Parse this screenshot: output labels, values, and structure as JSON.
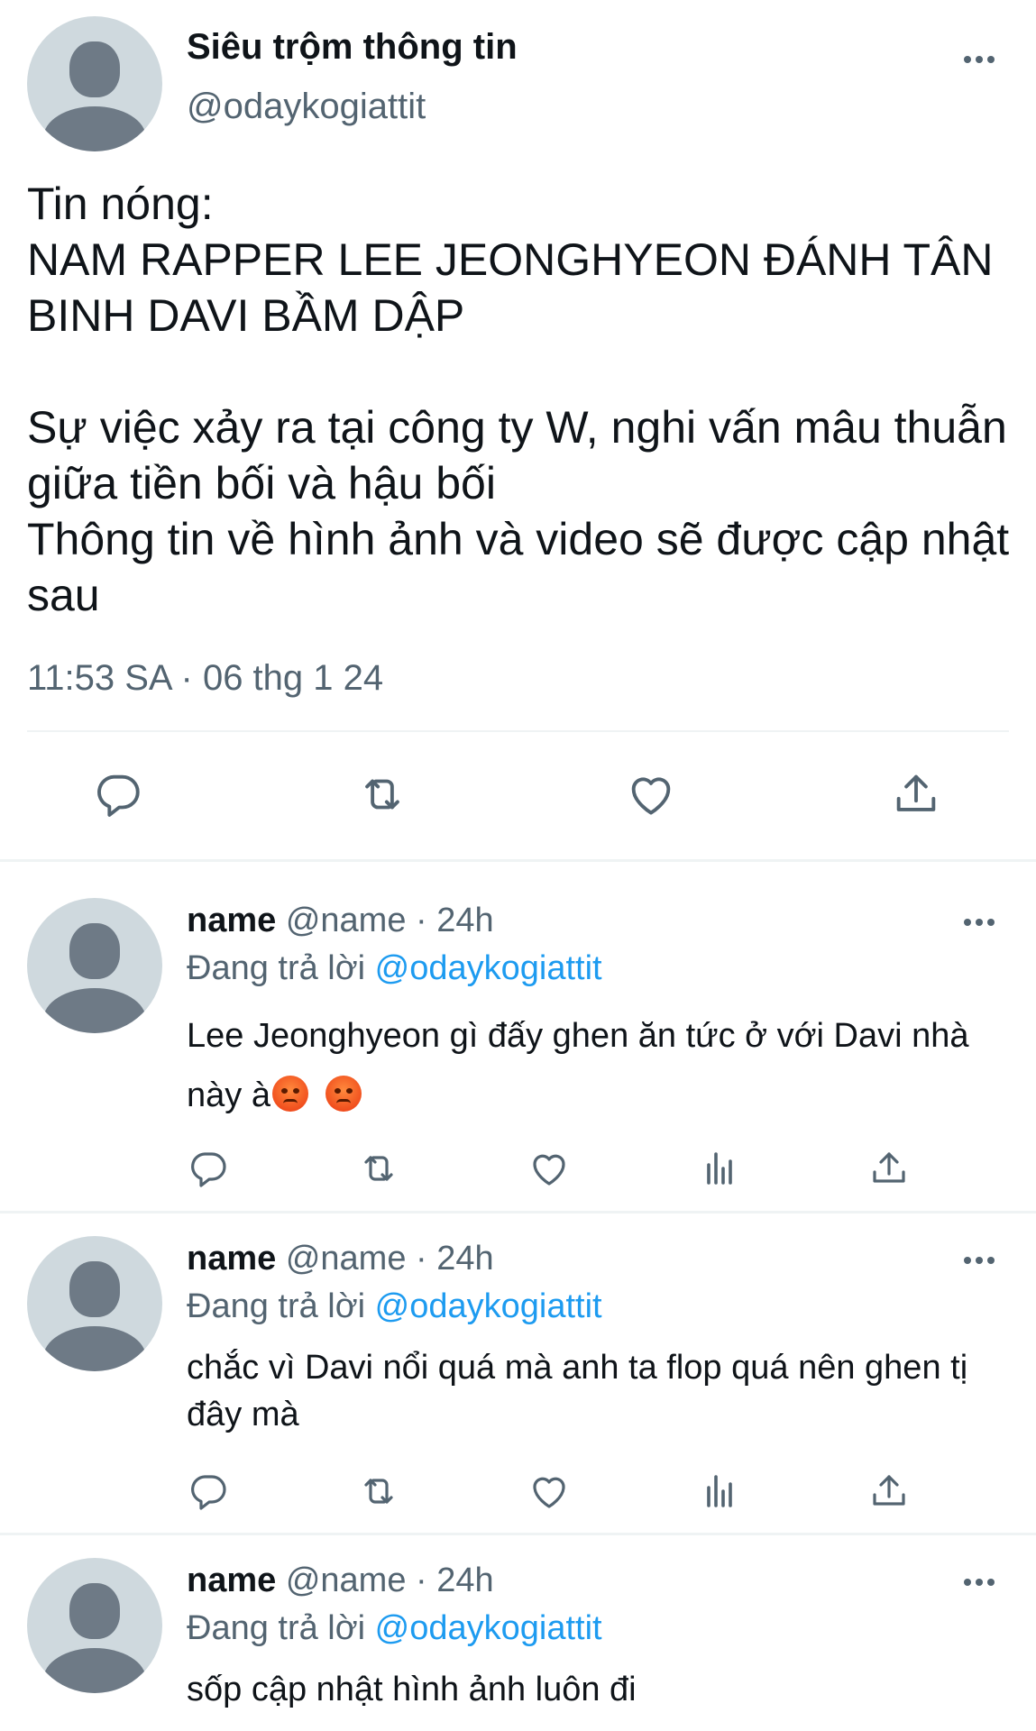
{
  "main_tweet": {
    "display_name": "Siêu trộm thông tin",
    "handle": "@odaykogiattit",
    "text": "Tin nóng:\nNAM RAPPER LEE JEONGHYEON ĐÁNH TÂN BINH DAVI BẦM DẬP\n\nSự việc xảy ra tại công ty W, nghi vấn mâu thuẫn giữa tiền bối và hậu bối\nThông tin về hình ảnh và video sẽ được cập nhật sau",
    "timestamp": "11:53 SA · 06 thg 1 24"
  },
  "replies": [
    {
      "display_name": "name",
      "handle": "@name",
      "time": "· 24h",
      "replying_label": "Đang trả lời",
      "replying_to": "@odaykogiattit",
      "text": "Lee Jeonghyeon gì đấy ghen ăn tức ở với Davi nhà này à",
      "emoji": [
        "angry-face",
        "angry-face"
      ]
    },
    {
      "display_name": "name",
      "handle": "@name",
      "time": "· 24h",
      "replying_label": "Đang trả lời",
      "replying_to": "@odaykogiattit",
      "text": "chắc vì Davi nổi quá mà anh ta flop quá nên ghen tị đây mà"
    },
    {
      "display_name": "name",
      "handle": "@name",
      "time": "· 24h",
      "replying_label": "Đang trả lời",
      "replying_to": "@odaykogiattit",
      "text": "sốp cập nhật hình ảnh luôn đi"
    }
  ],
  "colors": {
    "text": "#0f1419",
    "secondary": "#536471",
    "link": "#1d9bf0",
    "divider": "#eff3f4",
    "avatar_bg": "#cfd9de",
    "avatar_fg": "#6e7a86"
  },
  "icons": [
    "more-icon",
    "reply-icon",
    "retweet-icon",
    "like-icon",
    "views-icon",
    "share-icon"
  ]
}
